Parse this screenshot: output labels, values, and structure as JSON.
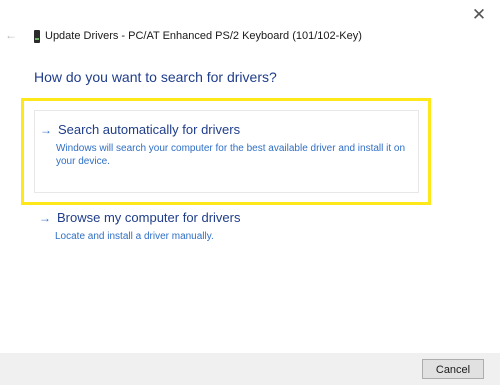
{
  "window": {
    "title": "Update Drivers - PC/AT Enhanced PS/2 Keyboard (101/102-Key)",
    "close_glyph": "✕",
    "back_glyph": "←"
  },
  "heading": "How do you want to search for drivers?",
  "options": [
    {
      "arrow": "→",
      "title": "Search automatically for drivers",
      "description": "Windows will search your computer for the best available driver and install it on your device.",
      "highlighted": true,
      "highlight_color": "#ffe81a"
    },
    {
      "arrow": "→",
      "title": "Browse my computer for drivers",
      "description": "Locate and install a driver manually.",
      "highlighted": false
    }
  ],
  "footer": {
    "cancel_label": "Cancel"
  },
  "colors": {
    "heading": "#1f3d8a",
    "link": "#2f6fc6",
    "highlight": "#ffe81a"
  }
}
